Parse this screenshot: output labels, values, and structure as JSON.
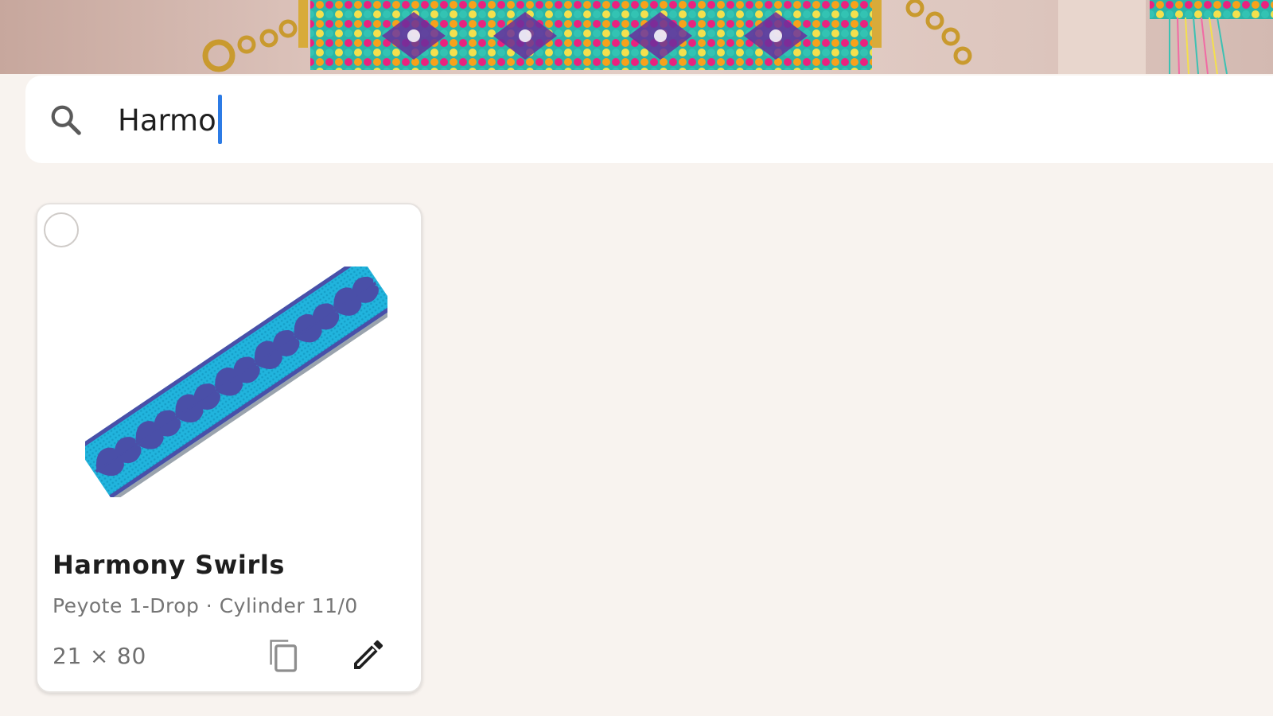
{
  "search": {
    "value": "Harmo",
    "icon": "search-icon"
  },
  "pattern_cards": [
    {
      "title": "Harmony Swirls",
      "subtitle": "Peyote 1-Drop · Cylinder 11/0",
      "dimensions": "21 × 80",
      "selected": false,
      "actions": [
        "copy-icon",
        "edit-icon"
      ]
    }
  ],
  "colors": {
    "background": "#f8f3ef",
    "card": "#ffffff",
    "caret": "#2c7be5",
    "bead_light": "#1fb3d9",
    "bead_dark": "#4a4fa8"
  }
}
